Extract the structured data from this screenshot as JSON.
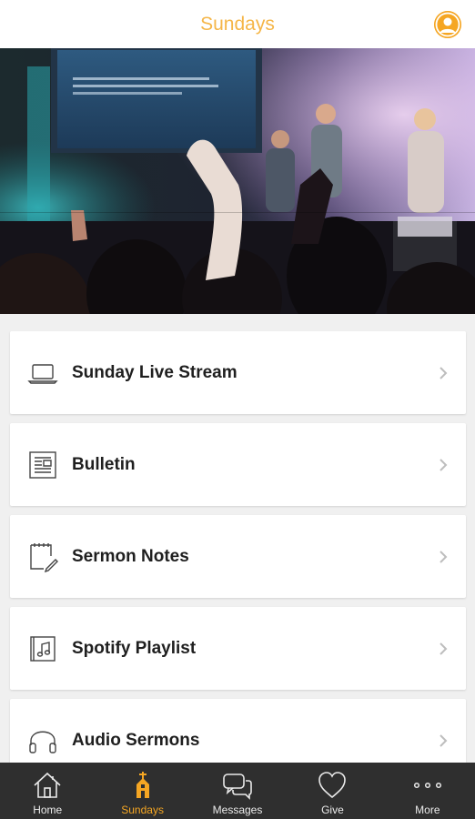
{
  "header": {
    "title": "Sundays",
    "avatar_icon": "user-avatar-icon",
    "accent_color": "#f5b648"
  },
  "hero": {
    "image": "worship-band-stage-photo"
  },
  "menu": {
    "items": [
      {
        "label": "Sunday Live Stream",
        "icon": "laptop-icon"
      },
      {
        "label": "Bulletin",
        "icon": "document-icon"
      },
      {
        "label": "Sermon Notes",
        "icon": "notepad-pencil-icon"
      },
      {
        "label": "Spotify Playlist",
        "icon": "music-note-icon"
      },
      {
        "label": "Audio Sermons",
        "icon": "headphones-icon"
      }
    ]
  },
  "tabbar": {
    "active_color": "#f5a623",
    "tabs": [
      {
        "label": "Home",
        "icon": "home-icon",
        "active": false
      },
      {
        "label": "Sundays",
        "icon": "church-icon",
        "active": true
      },
      {
        "label": "Messages",
        "icon": "chat-bubbles-icon",
        "active": false
      },
      {
        "label": "Give",
        "icon": "heart-icon",
        "active": false
      },
      {
        "label": "More",
        "icon": "more-dots-icon",
        "active": false
      }
    ]
  }
}
